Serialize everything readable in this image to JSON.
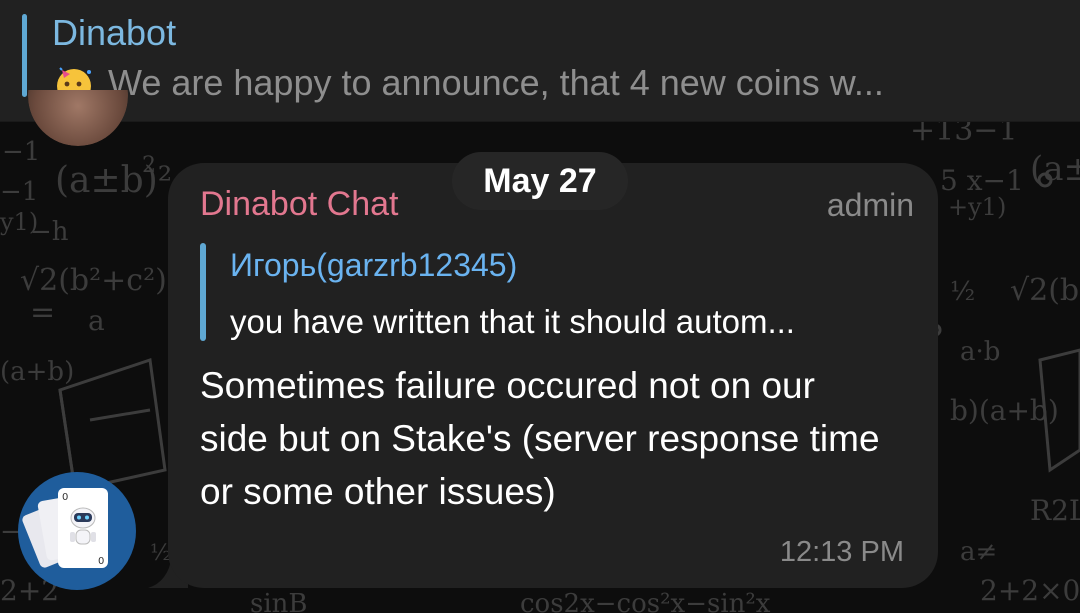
{
  "pinned": {
    "title": "Dinabot",
    "emoji": "partying-face-icon",
    "text": "We are happy to announce, that 4 new coins w..."
  },
  "date_pill": "May 27",
  "message": {
    "sender": "Dinabot Chat",
    "role": "admin",
    "reply": {
      "name": "Игорь(garzrb12345)",
      "text": "you have written that it should autom..."
    },
    "text": "Sometimes failure occured not on our side but on Stake's (server response time or some other issues)",
    "time": "12:13 PM"
  },
  "colors": {
    "accent_blue": "#5fa8d3",
    "sender_pink": "#e2778f",
    "bubble_bg": "#212121"
  }
}
